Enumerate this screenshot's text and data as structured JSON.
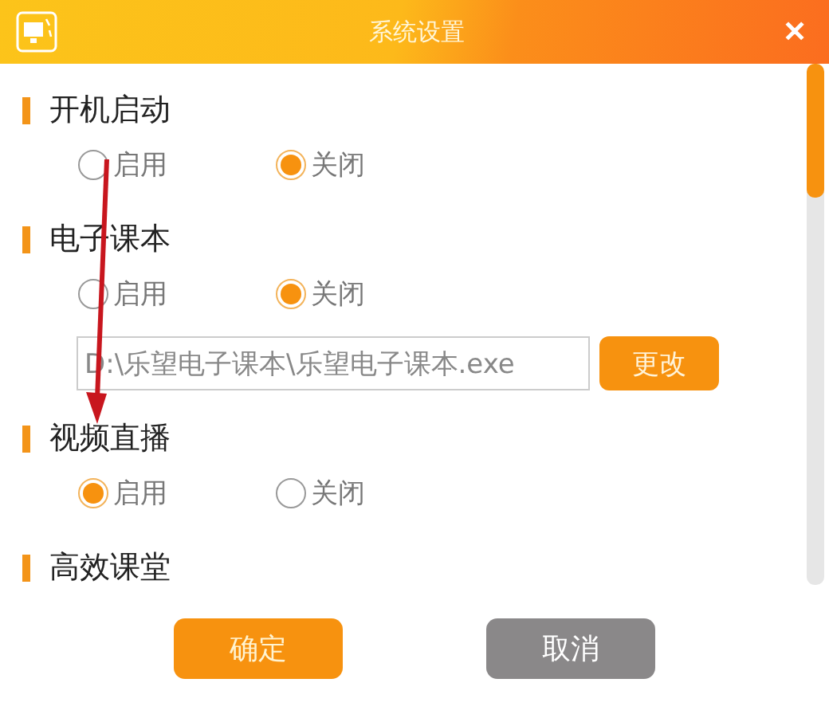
{
  "window": {
    "title": "系统设置",
    "close": "✕"
  },
  "sections": [
    {
      "title": "开机启动",
      "options": [
        {
          "label": "启用",
          "selected": false
        },
        {
          "label": "关闭",
          "selected": true
        }
      ]
    },
    {
      "title": "电子课本",
      "options": [
        {
          "label": "启用",
          "selected": false
        },
        {
          "label": "关闭",
          "selected": true
        }
      ],
      "path": {
        "value": "D:\\乐望电子课本\\乐望电子课本.exe",
        "button": "更改"
      }
    },
    {
      "title": "视频直播",
      "options": [
        {
          "label": "启用",
          "selected": true
        },
        {
          "label": "关闭",
          "selected": false
        }
      ]
    },
    {
      "title": "高效课堂"
    }
  ],
  "buttons": [
    {
      "label": "确定",
      "kind": "primary"
    },
    {
      "label": "取消",
      "kind": "secondary"
    }
  ]
}
